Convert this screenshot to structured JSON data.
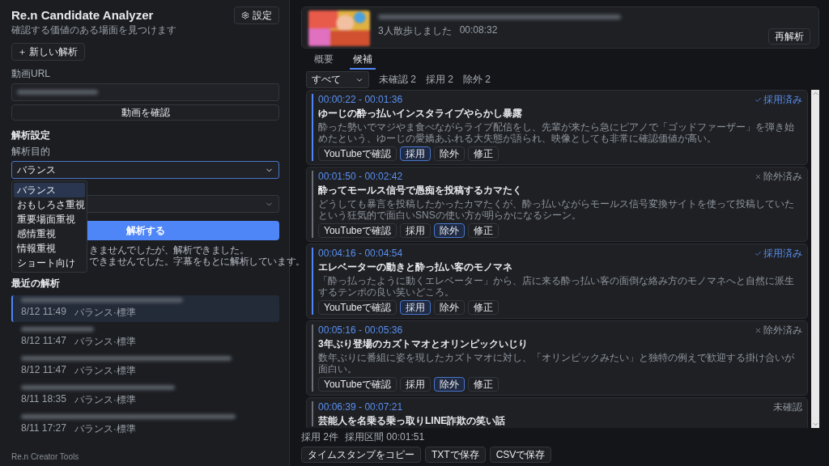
{
  "app": {
    "title": "Re.n Candidate Analyzer",
    "subtitle": "確認する価値のある場面を見つけます",
    "settings_button": "設定",
    "new_button": "新しい解析"
  },
  "url_field": {
    "label": "動画URL",
    "confirm_button": "動画を確認"
  },
  "settings": {
    "heading": "解析設定",
    "purpose_label": "解析目的",
    "purpose_value": "バランス",
    "options": [
      {
        "label": "バランス",
        "selected": true
      },
      {
        "label": "おもしろさ重視",
        "selected": false
      },
      {
        "label": "重要場面重視",
        "selected": false
      },
      {
        "label": "感情重視",
        "selected": false
      },
      {
        "label": "情報重視",
        "selected": false
      },
      {
        "label": "ショート向け",
        "selected": false
      }
    ],
    "analyze_button": "解析する",
    "notice": [
      "きませんでしたが、解析できました。",
      "できませんでした。字幕をもとに解析しています。"
    ]
  },
  "recent": {
    "heading": "最近の解析",
    "items": [
      {
        "time": "8/12 11:49",
        "mode": "バランス·標準",
        "selected": true
      },
      {
        "time": "8/12 11:47",
        "mode": "バランス·標準",
        "selected": false
      },
      {
        "time": "8/12 11:47",
        "mode": "バランス·標準",
        "selected": false
      },
      {
        "time": "8/11 18:35",
        "mode": "バランス·標準",
        "selected": false
      },
      {
        "time": "8/11 17:27",
        "mode": "バランス·標準",
        "selected": false
      }
    ]
  },
  "footer": "Re.n Creator Tools",
  "video": {
    "meta": "3人散歩しました",
    "duration": "00:08:32",
    "reanalyze_button": "再解析"
  },
  "tabs": [
    {
      "label": "概要",
      "selected": false
    },
    {
      "label": "候補",
      "selected": true
    }
  ],
  "filter": {
    "value": "すべて",
    "counts": [
      "未確認 2",
      "採用 2",
      "除外 2"
    ]
  },
  "candidates": [
    {
      "range": "00:00:22 - 00:01:36",
      "kind": "adopted",
      "status_label": "採用済み",
      "title": "ゆーじの酔っ払いインスタライブやらかし暴露",
      "description": "酔った勢いでマジやま食べながらライブ配信をし、先輩が来たら急にピアノで「ゴッドファーザー」を弾き始めたという、ゆーじの愛嬌あふれる大失態が語られ、映像としても非常に確認価値が高い。",
      "buttons": [
        {
          "label": "YouTubeで確認",
          "selected": false
        },
        {
          "label": "採用",
          "selected": true
        },
        {
          "label": "除外",
          "selected": false
        },
        {
          "label": "修正",
          "selected": false
        }
      ]
    },
    {
      "range": "00:01:50 - 00:02:42",
      "kind": "excluded",
      "status_label": "除外済み",
      "title": "酔ってモールス信号で愚痴を投稿するカマたく",
      "description": "どうしても暴言を投稿したかったカマたくが、酔っ払いながらモールス信号変換サイトを使って投稿していたという狂気的で面白いSNSの使い方が明らかになるシーン。",
      "buttons": [
        {
          "label": "YouTubeで確認",
          "selected": false
        },
        {
          "label": "採用",
          "selected": false
        },
        {
          "label": "除外",
          "selected": true
        },
        {
          "label": "修正",
          "selected": false
        }
      ]
    },
    {
      "range": "00:04:16 - 00:04:54",
      "kind": "adopted",
      "status_label": "採用済み",
      "title": "エレベーターの動きと酔っ払い客のモノマネ",
      "description": "「酔っ払ったように動くエレベーター」から、店に来る酔っ払い客の面倒な絡み方のモノマネへと自然に派生するテンポの良い笑いどころ。",
      "buttons": [
        {
          "label": "YouTubeで確認",
          "selected": false
        },
        {
          "label": "採用",
          "selected": true
        },
        {
          "label": "除外",
          "selected": false
        },
        {
          "label": "修正",
          "selected": false
        }
      ]
    },
    {
      "range": "00:05:16 - 00:05:36",
      "kind": "excluded",
      "status_label": "除外済み",
      "title": "3年ぶり登場のカズトマオとオリンピックいじり",
      "description": "数年ぶりに番組に姿を現したカズトマオに対し、「オリンピックみたい」と独特の例えで歓迎する掛け合いが面白い。",
      "buttons": [
        {
          "label": "YouTubeで確認",
          "selected": false
        },
        {
          "label": "採用",
          "selected": false
        },
        {
          "label": "除外",
          "selected": true
        },
        {
          "label": "修正",
          "selected": false
        }
      ]
    },
    {
      "range": "00:06:39 - 00:07:21",
      "kind": "pending",
      "status_label": "未確認",
      "title": "芸能人を名乗る乗っ取りLINE詐欺の笑い話"
    }
  ],
  "summary": {
    "adopted": "採用 2件",
    "span": "採用区間 00:01:51"
  },
  "export_buttons": [
    "タイムスタンプをコピー",
    "TXTで保存",
    "CSVで保存"
  ]
}
